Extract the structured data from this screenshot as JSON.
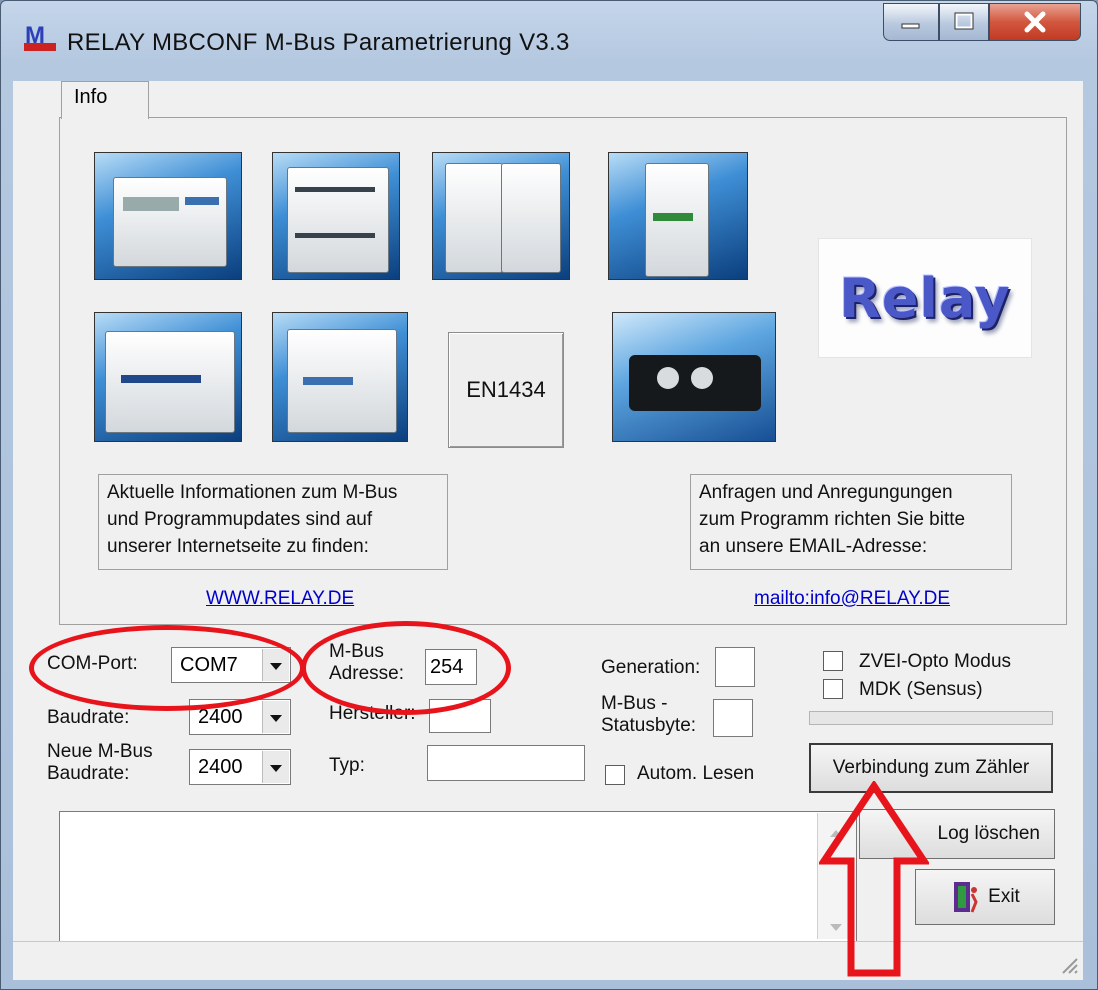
{
  "window": {
    "title": "RELAY MBCONF  M-Bus Parametrierung  V3.3",
    "icon": "relay-m-logo-icon"
  },
  "tab": {
    "label": "Info"
  },
  "info": {
    "en_button": "EN1434",
    "logo_text": "Relay",
    "left_box": [
      "Aktuelle Informationen zum M-Bus",
      "und Programmupdates sind auf",
      "unserer Internetseite zu finden:"
    ],
    "right_box": [
      "Anfragen und Anregungungen",
      "zum Programm richten Sie bitte",
      "an unsere EMAIL-Adresse:"
    ],
    "website_link": "WWW.RELAY.DE",
    "email_link": "mailto:info@RELAY.DE"
  },
  "form": {
    "com_port_label": "COM-Port:",
    "com_port_value": "COM7",
    "baudrate_label": "Baudrate:",
    "baudrate_value": "2400",
    "new_baud_label_1": "Neue M-Bus",
    "new_baud_label_2": "Baudrate:",
    "new_baud_value": "2400",
    "address_label_1": "M-Bus",
    "address_label_2": "Adresse:",
    "address_value": "254",
    "manufacturer_label": "Hersteller:",
    "manufacturer_value": "",
    "type_label": "Typ:",
    "type_value": "",
    "generation_label": "Generation:",
    "generation_value": "",
    "status_label_1": "M-Bus -",
    "status_label_2": "Statusbyte:",
    "status_value": "",
    "auto_read_label": "Autom. Lesen",
    "zvei_label": "ZVEI-Opto Modus",
    "mdk_label": "MDK (Sensus)"
  },
  "buttons": {
    "connect": "Verbindung zum Zähler",
    "clear_log": "Log löschen",
    "exit": "Exit"
  },
  "annotation_color": "#e8141c"
}
